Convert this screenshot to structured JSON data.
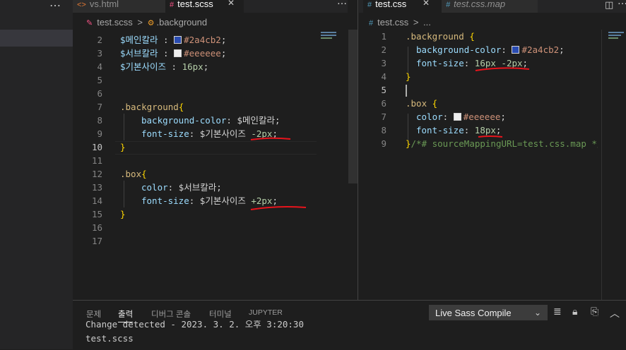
{
  "sidebar": {
    "more_label": "…"
  },
  "left_tabs": [
    {
      "icon": "<>",
      "label": "vs.html"
    },
    {
      "icon": "#",
      "label": "test.scss"
    }
  ],
  "left_more": "…",
  "right_tabs": [
    {
      "icon": "#",
      "label": "test.css"
    },
    {
      "icon": "#",
      "label": "test.css.map"
    }
  ],
  "left_breadcrumb": {
    "file": "test.scss",
    "sep": ">",
    "symbol": ".background"
  },
  "right_breadcrumb": {
    "file": "test.css",
    "sep": ">",
    "rest": "..."
  },
  "left_editor": {
    "line_numbers": [
      "2",
      "3",
      "4",
      "5",
      "6",
      "7",
      "8",
      "9",
      "10",
      "11",
      "12",
      "13",
      "14",
      "15",
      "16",
      "17"
    ],
    "current_line": "10",
    "lines": [
      {
        "var": "$메인칼라",
        "sep": " :",
        "color": "#2a4cb2",
        "value": "#2a4cb2",
        "end": ";"
      },
      {
        "var": "$서브칼라",
        "sep": " :",
        "color": "#eeeeee",
        "value": "#eeeeee",
        "end": ";"
      },
      {
        "var": "$기본사이즈",
        "sep": " : ",
        "value": "16px",
        "end": ";"
      },
      {
        "sel": ".background",
        "brace": "{"
      },
      {
        "prop": "background-color",
        "colon": ": ",
        "var": "$메인칼라",
        "end": ";"
      },
      {
        "prop": "font-size",
        "colon": ": ",
        "var": "$기본사이즈",
        "num": "-2px",
        "end": ";"
      },
      {
        "brace": "}"
      },
      {
        "sel": ".box",
        "brace": "{"
      },
      {
        "prop": "color",
        "colon": ": ",
        "var": "$서브칼라",
        "end": ";"
      },
      {
        "prop": "font-size",
        "colon": ": ",
        "var": "$기본사이즈",
        "num": "+2px",
        "end": ";"
      },
      {
        "brace": "}"
      }
    ]
  },
  "right_editor": {
    "line_numbers": [
      "1",
      "2",
      "3",
      "4",
      "5",
      "6",
      "7",
      "8",
      "9"
    ],
    "current_line": "5",
    "lines": [
      {
        "sel": ".background",
        "brace": "{"
      },
      {
        "prop": "background-color",
        "colon": ": ",
        "color": "#2a4cb2",
        "value": "#2a4cb2",
        "end": ";"
      },
      {
        "prop": "font-size",
        "colon": ": ",
        "value": "16px -2px",
        "end": ";"
      },
      {
        "brace": "}"
      },
      {
        "sel": ".box",
        "brace": "{"
      },
      {
        "prop": "color",
        "colon": ": ",
        "color": "#eeeeee",
        "value": "#eeeeee",
        "end": ";"
      },
      {
        "prop": "font-size",
        "colon": ": ",
        "value": "18px",
        "end": ";"
      },
      {
        "brace": "}",
        "comment": "/*# sourceMappingURL=test.css.map */"
      }
    ]
  },
  "panel": {
    "tabs": [
      "문제",
      "출력",
      "디버그 콘솔",
      "터미널",
      "JUPYTER"
    ],
    "active_tab": "출력",
    "output_channel": "Live Sass Compile",
    "output_lines": [
      "Change detected - 2023. 3. 2. 오후 3:20:30",
      "test.scss"
    ]
  },
  "colors": {
    "annotation_red": "#e8141c",
    "tab_active_fg": "#ffffff",
    "scss_icon": "#f55385",
    "css_icon": "#519aba",
    "html_icon": "#e37933"
  }
}
